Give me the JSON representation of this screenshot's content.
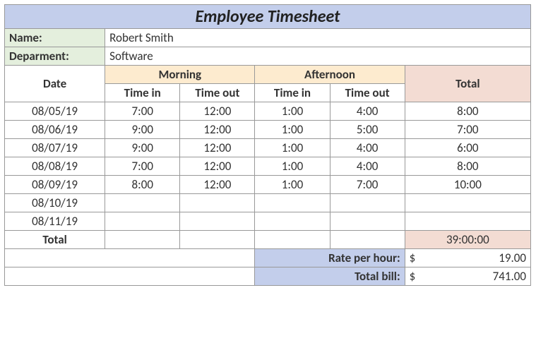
{
  "title": "Employee Timesheet",
  "fields": {
    "name_label": "Name:",
    "name_value": "Robert Smith",
    "dept_label": "Deparment:",
    "dept_value": "Software"
  },
  "headers": {
    "date": "Date",
    "morning": "Morning",
    "afternoon": "Afternoon",
    "total": "Total",
    "time_in": "Time in",
    "time_out": "Time out"
  },
  "rows": [
    {
      "date": "08/05/19",
      "m_in": "7:00",
      "m_out": "12:00",
      "a_in": "1:00",
      "a_out": "4:00",
      "total": "8:00"
    },
    {
      "date": "08/06/19",
      "m_in": "9:00",
      "m_out": "12:00",
      "a_in": "1:00",
      "a_out": "5:00",
      "total": "7:00"
    },
    {
      "date": "08/07/19",
      "m_in": "9:00",
      "m_out": "12:00",
      "a_in": "1:00",
      "a_out": "4:00",
      "total": "6:00"
    },
    {
      "date": "08/08/19",
      "m_in": "7:00",
      "m_out": "12:00",
      "a_in": "1:00",
      "a_out": "4:00",
      "total": "8:00"
    },
    {
      "date": "08/09/19",
      "m_in": "8:00",
      "m_out": "12:00",
      "a_in": "1:00",
      "a_out": "7:00",
      "total": "10:00"
    },
    {
      "date": "08/10/19",
      "m_in": "",
      "m_out": "",
      "a_in": "",
      "a_out": "",
      "total": ""
    },
    {
      "date": "08/11/19",
      "m_in": "",
      "m_out": "",
      "a_in": "",
      "a_out": "",
      "total": ""
    }
  ],
  "footer": {
    "total_label": "Total",
    "total_hours": "39:00:00",
    "rate_label": "Rate per hour:",
    "rate_currency": "$",
    "rate_value": "19.00",
    "bill_label": "Total bill:",
    "bill_currency": "$",
    "bill_value": "741.00"
  }
}
